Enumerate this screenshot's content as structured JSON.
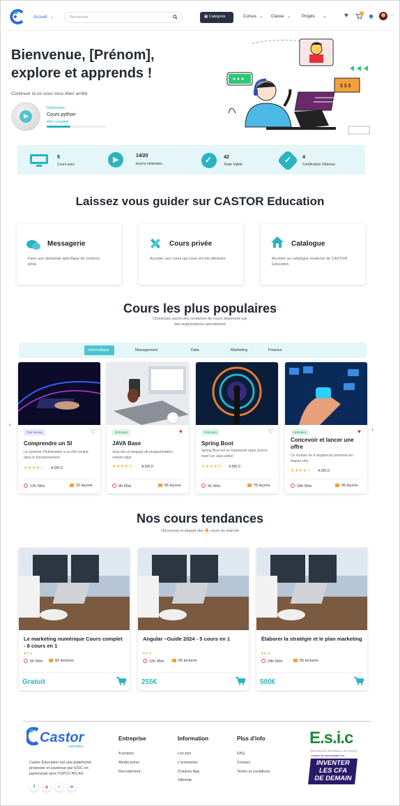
{
  "nav": {
    "home": "Accueil",
    "search_placeholder": "Recherche",
    "category_button": "Catégorie",
    "menu": [
      "Cursus",
      "Classe",
      "Projets"
    ],
    "cart_count": "0"
  },
  "hero": {
    "title_line1": "Bienvenue, [Prénom],",
    "title_line2": "explore et apprends !",
    "resume_text": "Continuer là où vous vous étiez arrêté",
    "resume_label": "Reprendre",
    "course_name": "Cours python",
    "progress_text": "40% complété",
    "progress": 0.4
  },
  "stats": [
    {
      "value": "5",
      "label": "Cours suivi",
      "icon": "monitor-icon"
    },
    {
      "value": "14/20",
      "label": "leçons entamées",
      "icon": "play-icon"
    },
    {
      "value": "42",
      "label": "Teste Validé",
      "icon": "check-icon"
    },
    {
      "value": "4",
      "label": "Certification Obtenue",
      "icon": "badge-check-icon"
    }
  ],
  "guide": {
    "title": "Laissez vous guider sur CASTOR Education",
    "cards": [
      {
        "title": "Messagerie",
        "desc": "Faire une demande spécifique de contenu péda",
        "icon": "chat-icon"
      },
      {
        "title": "Cours privée",
        "desc": "Accéder aux cours qui vous ont été attribués",
        "icon": "ruler-pencil-icon"
      },
      {
        "title": "Catalogue",
        "desc": "Accéder au catalogue moderne de CASTOR Education",
        "icon": "home-icon"
      }
    ]
  },
  "popular": {
    "title": "Cours les plus populaires",
    "subtitle_line1": "Choisissez parmi des centaines de cours dispensés par",
    "subtitle_line2": "des organisations spécialisées",
    "tabs": [
      "Informatique",
      "Management",
      "Data",
      "Marketing",
      "Finance"
    ],
    "active_tab": 0,
    "courses": [
      {
        "badge": "Tout niveau",
        "title": "Comprendre un SI",
        "desc": "Le système d'information a un rôle central dans le fonctionnement",
        "rating": "4.0/5.0",
        "duration": "12h 56m",
        "lessons": "15 leçons",
        "liked": false
      },
      {
        "badge": "Debutant",
        "title": "JAVA Base",
        "desc": "Java est un langage de programmation orienté objet",
        "rating": "4.5/5.0",
        "duration": "9h 56m",
        "lessons": "65 leçons",
        "liked": true
      },
      {
        "badge": "Debutant",
        "title": "Spring Boot",
        "desc": "Spring Boot est un framework open source basé sur Java utilisé",
        "rating": "4.5/5.0",
        "duration": "5h 56m",
        "lessons": "75 leçons",
        "liked": false
      },
      {
        "badge": "Debutant",
        "title": "Concevoir et lancer une offre",
        "desc": "Ce module en 4 séquences présente les étapes clés",
        "rating": "4.0/5.0",
        "duration": "18h 56m",
        "lessons": "99 leçons",
        "liked": true
      }
    ]
  },
  "trending": {
    "title": "Nos cours tendances",
    "subtitle": "Découvrez la plupart des 🔥 cours du marché",
    "courses": [
      {
        "title": "Le marketing numérique Cours complet - 8 cours en 1",
        "rating": "4.0",
        "duration": "6h 56m",
        "lessons": "82 lectures",
        "price": "Gratuit"
      },
      {
        "title": "Angular –Guide 2024 - 5 cours en 1",
        "rating": "4.0",
        "duration": "12h 45m",
        "lessons": "65 lectures",
        "price": "255€"
      },
      {
        "title": "Élaborer la stratégie et le plan marketing",
        "rating": "4.5",
        "duration": "24h 56m",
        "lessons": "55 lectures",
        "price": "500€"
      }
    ]
  },
  "footer": {
    "brand": "Castor",
    "brand_sub": "education",
    "about": "Castor Éducation est une plateforme proposée et soutenue par ESIC en partenariat avec l'OPCO ATLAS",
    "columns": [
      {
        "title": "Entreprise",
        "links": [
          "A propos",
          "Media press",
          "Recrutement"
        ]
      },
      {
        "title": "Information",
        "links": [
          "Les prix",
          "L'entreprise",
          "D'autres App",
          "Sitemap"
        ]
      },
      {
        "title": "Plus d'info",
        "links": [
          "FAQ",
          "Contact",
          "Terms et conditions"
        ]
      }
    ],
    "partner_logo": "E.s.i.c",
    "partner_tagline": "École Supérieure d'Informatique et de Commerce",
    "partner_small": "LAURÉAT DU PROGRAMME ÉTAT",
    "partner_banner": [
      "INVENTER",
      "LES CFA",
      "DE DEMAIN"
    ],
    "social": [
      "f",
      "ig",
      "tw",
      "in"
    ]
  },
  "colors": {
    "accent": "#2bb3c0",
    "dark": "#2a3142",
    "light_teal": "#e4f6f7",
    "star": "#f6b81c",
    "heart": "#e0262f"
  }
}
